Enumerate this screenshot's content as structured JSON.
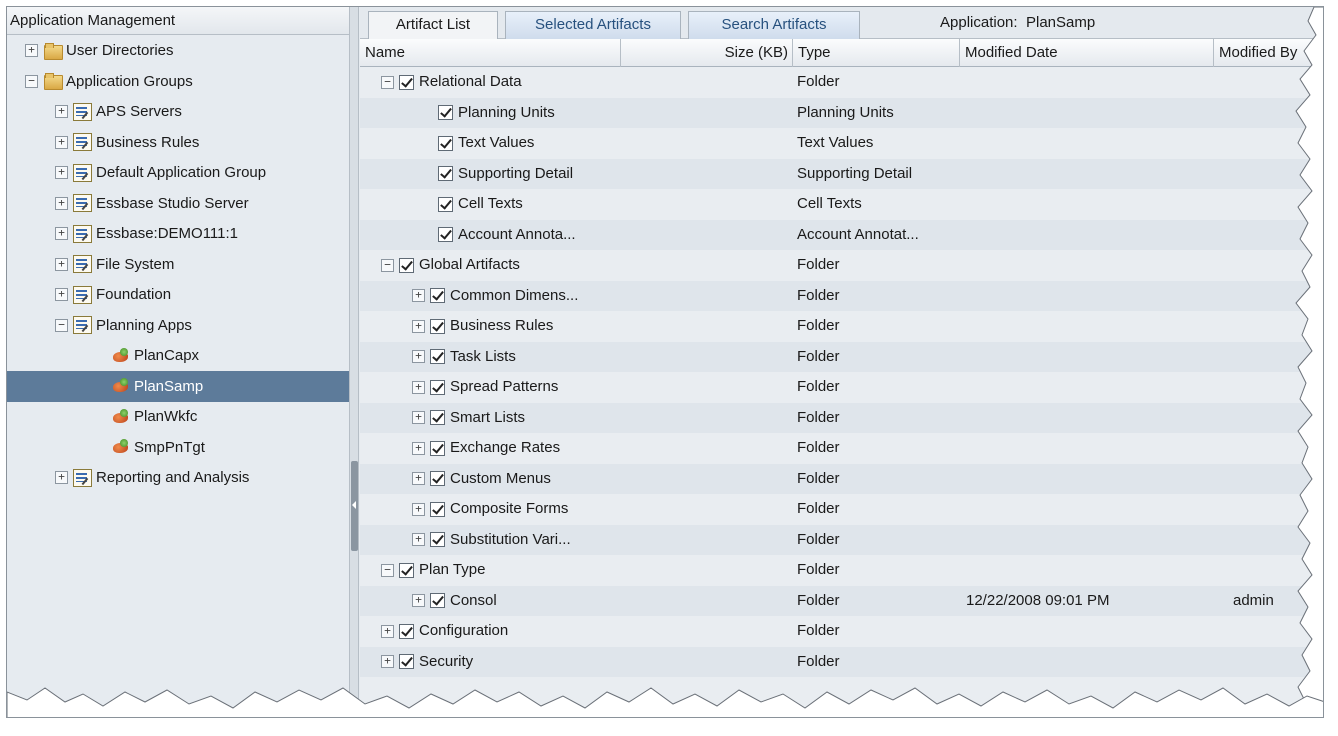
{
  "left_panel": {
    "title": "Application Management",
    "tree": [
      {
        "label": "User Directories",
        "toggle": "+",
        "icon": "folder-icon",
        "level": 0
      },
      {
        "label": "Application Groups",
        "toggle": "−",
        "icon": "folder-icon",
        "level": 0
      },
      {
        "label": "APS Servers",
        "toggle": "+",
        "icon": "application-group-icon",
        "level": 1
      },
      {
        "label": "Business Rules",
        "toggle": "+",
        "icon": "application-group-icon",
        "level": 1
      },
      {
        "label": "Default Application Group",
        "toggle": "+",
        "icon": "application-group-icon",
        "level": 1
      },
      {
        "label": "Essbase Studio Server",
        "toggle": "+",
        "icon": "application-group-icon",
        "level": 1
      },
      {
        "label": "Essbase:DEMO111:1",
        "toggle": "+",
        "icon": "application-group-icon",
        "level": 1
      },
      {
        "label": "File System",
        "toggle": "+",
        "icon": "application-group-icon",
        "level": 1
      },
      {
        "label": "Foundation",
        "toggle": "+",
        "icon": "application-group-icon",
        "level": 1
      },
      {
        "label": "Planning Apps",
        "toggle": "−",
        "icon": "application-group-icon",
        "level": 1
      },
      {
        "label": "PlanCapx",
        "toggle": "",
        "icon": "planning-app-icon",
        "level": 2
      },
      {
        "label": "PlanSamp",
        "toggle": "",
        "icon": "planning-app-icon",
        "level": 2,
        "selected": true
      },
      {
        "label": "PlanWkfc",
        "toggle": "",
        "icon": "planning-app-icon",
        "level": 2
      },
      {
        "label": "SmpPnTgt",
        "toggle": "",
        "icon": "planning-app-icon",
        "level": 2
      },
      {
        "label": "Reporting and Analysis",
        "toggle": "+",
        "icon": "application-group-icon",
        "level": 1
      }
    ]
  },
  "tabs": {
    "artifact_list": "Artifact List",
    "selected_artifacts": "Selected Artifacts",
    "search_artifacts": "Search Artifacts"
  },
  "application": {
    "label": "Application:",
    "name": "PlanSamp"
  },
  "columns": {
    "name": "Name",
    "size": "Size (KB)",
    "type": "Type",
    "modified_date": "Modified Date",
    "modified_by": "Modified By"
  },
  "artifacts": [
    {
      "name": "Relational Data",
      "toggle": "−",
      "checked": true,
      "level": 0,
      "type": "Folder",
      "modified_date": "",
      "modified_by": ""
    },
    {
      "name": "Planning Units",
      "toggle": "",
      "checked": true,
      "level": 1,
      "type": "Planning Units",
      "modified_date": "",
      "modified_by": ""
    },
    {
      "name": "Text Values",
      "toggle": "",
      "checked": true,
      "level": 1,
      "type": "Text Values",
      "modified_date": "",
      "modified_by": ""
    },
    {
      "name": "Supporting Detail",
      "toggle": "",
      "checked": true,
      "level": 1,
      "type": "Supporting Detail",
      "modified_date": "",
      "modified_by": ""
    },
    {
      "name": "Cell Texts",
      "toggle": "",
      "checked": true,
      "level": 1,
      "type": "Cell Texts",
      "modified_date": "",
      "modified_by": ""
    },
    {
      "name": "Account Annota...",
      "toggle": "",
      "checked": true,
      "level": 1,
      "type": "Account Annotat...",
      "modified_date": "",
      "modified_by": ""
    },
    {
      "name": "Global Artifacts",
      "toggle": "−",
      "checked": true,
      "level": 0,
      "type": "Folder",
      "modified_date": "",
      "modified_by": ""
    },
    {
      "name": "Common Dimens...",
      "toggle": "+",
      "checked": true,
      "level": 1,
      "type": "Folder",
      "modified_date": "",
      "modified_by": ""
    },
    {
      "name": "Business Rules",
      "toggle": "+",
      "checked": true,
      "level": 1,
      "type": "Folder",
      "modified_date": "",
      "modified_by": ""
    },
    {
      "name": "Task Lists",
      "toggle": "+",
      "checked": true,
      "level": 1,
      "type": "Folder",
      "modified_date": "",
      "modified_by": ""
    },
    {
      "name": "Spread Patterns",
      "toggle": "+",
      "checked": true,
      "level": 1,
      "type": "Folder",
      "modified_date": "",
      "modified_by": ""
    },
    {
      "name": "Smart Lists",
      "toggle": "+",
      "checked": true,
      "level": 1,
      "type": "Folder",
      "modified_date": "",
      "modified_by": ""
    },
    {
      "name": "Exchange Rates",
      "toggle": "+",
      "checked": true,
      "level": 1,
      "type": "Folder",
      "modified_date": "",
      "modified_by": ""
    },
    {
      "name": "Custom Menus",
      "toggle": "+",
      "checked": true,
      "level": 1,
      "type": "Folder",
      "modified_date": "",
      "modified_by": ""
    },
    {
      "name": "Composite Forms",
      "toggle": "+",
      "checked": true,
      "level": 1,
      "type": "Folder",
      "modified_date": "",
      "modified_by": ""
    },
    {
      "name": "Substitution Vari...",
      "toggle": "+",
      "checked": true,
      "level": 1,
      "type": "Folder",
      "modified_date": "",
      "modified_by": ""
    },
    {
      "name": "Plan Type",
      "toggle": "−",
      "checked": true,
      "level": 0,
      "type": "Folder",
      "modified_date": "",
      "modified_by": ""
    },
    {
      "name": "Consol",
      "toggle": "+",
      "checked": true,
      "level": 1,
      "type": "Folder",
      "modified_date": "12/22/2008 09:01 PM",
      "modified_by": "admin"
    },
    {
      "name": "Configuration",
      "toggle": "+",
      "checked": true,
      "level": 0,
      "type": "Folder",
      "modified_date": "",
      "modified_by": ""
    },
    {
      "name": "Security",
      "toggle": "+",
      "checked": true,
      "level": 0,
      "type": "Folder",
      "modified_date": "",
      "modified_by": ""
    }
  ],
  "colors": {
    "selection": "#5d7b9a",
    "panel_bg": "#e6ebf0",
    "alt_row": "#dfe5eb",
    "tab_text": "#27517e"
  }
}
